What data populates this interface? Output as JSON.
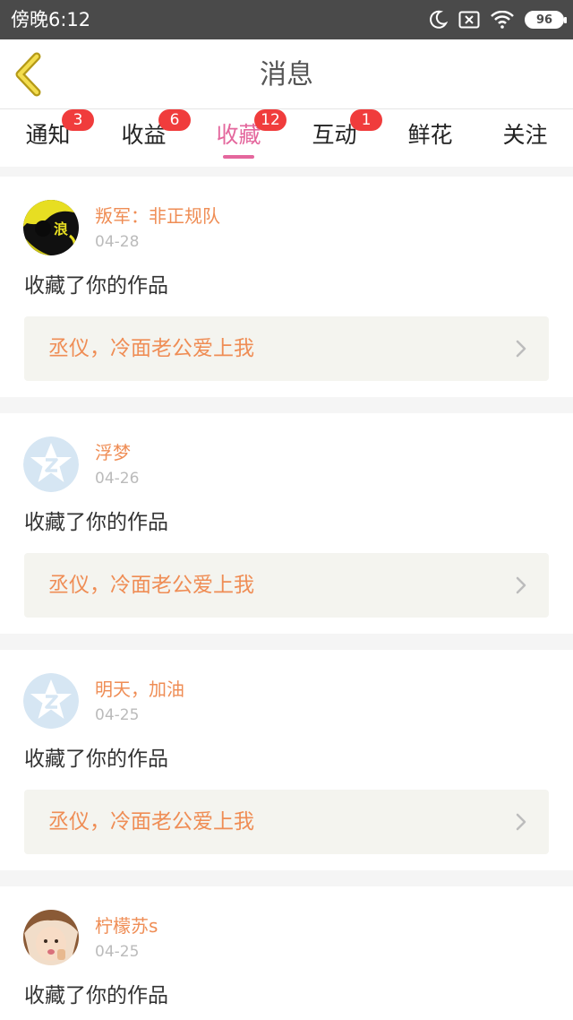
{
  "status": {
    "time": "傍晚6:12",
    "battery": "96",
    "icons": [
      "moon-icon",
      "sim-x-icon",
      "wifi-icon",
      "battery-icon"
    ]
  },
  "header": {
    "title": "消息"
  },
  "tabs": [
    {
      "label": "通知",
      "badge": "3"
    },
    {
      "label": "收益",
      "badge": "6"
    },
    {
      "label": "收藏",
      "badge": "12",
      "active": true
    },
    {
      "label": "互动",
      "badge": "1"
    },
    {
      "label": "鲜花",
      "badge": ""
    },
    {
      "label": "关注",
      "badge": ""
    }
  ],
  "messages": [
    {
      "user": "叛军：非正规队",
      "avatar_text": "浪",
      "date": "04-28",
      "action": "收藏了你的作品",
      "work": "丞仪，冷面老公爱上我"
    },
    {
      "user": "浮梦",
      "date": "04-26",
      "action": "收藏了你的作品",
      "work": "丞仪，冷面老公爱上我"
    },
    {
      "user": "明天，加油",
      "date": "04-25",
      "action": "收藏了你的作品",
      "work": "丞仪，冷面老公爱上我"
    },
    {
      "user": "柠檬苏s",
      "date": "04-25",
      "action": "收藏了你的作品"
    }
  ],
  "colors": {
    "accent_pink": "#e4679d",
    "name_orange": "#ef8d55",
    "badge_red": "#f03c3c",
    "status_bar": "#4a4a4a"
  }
}
